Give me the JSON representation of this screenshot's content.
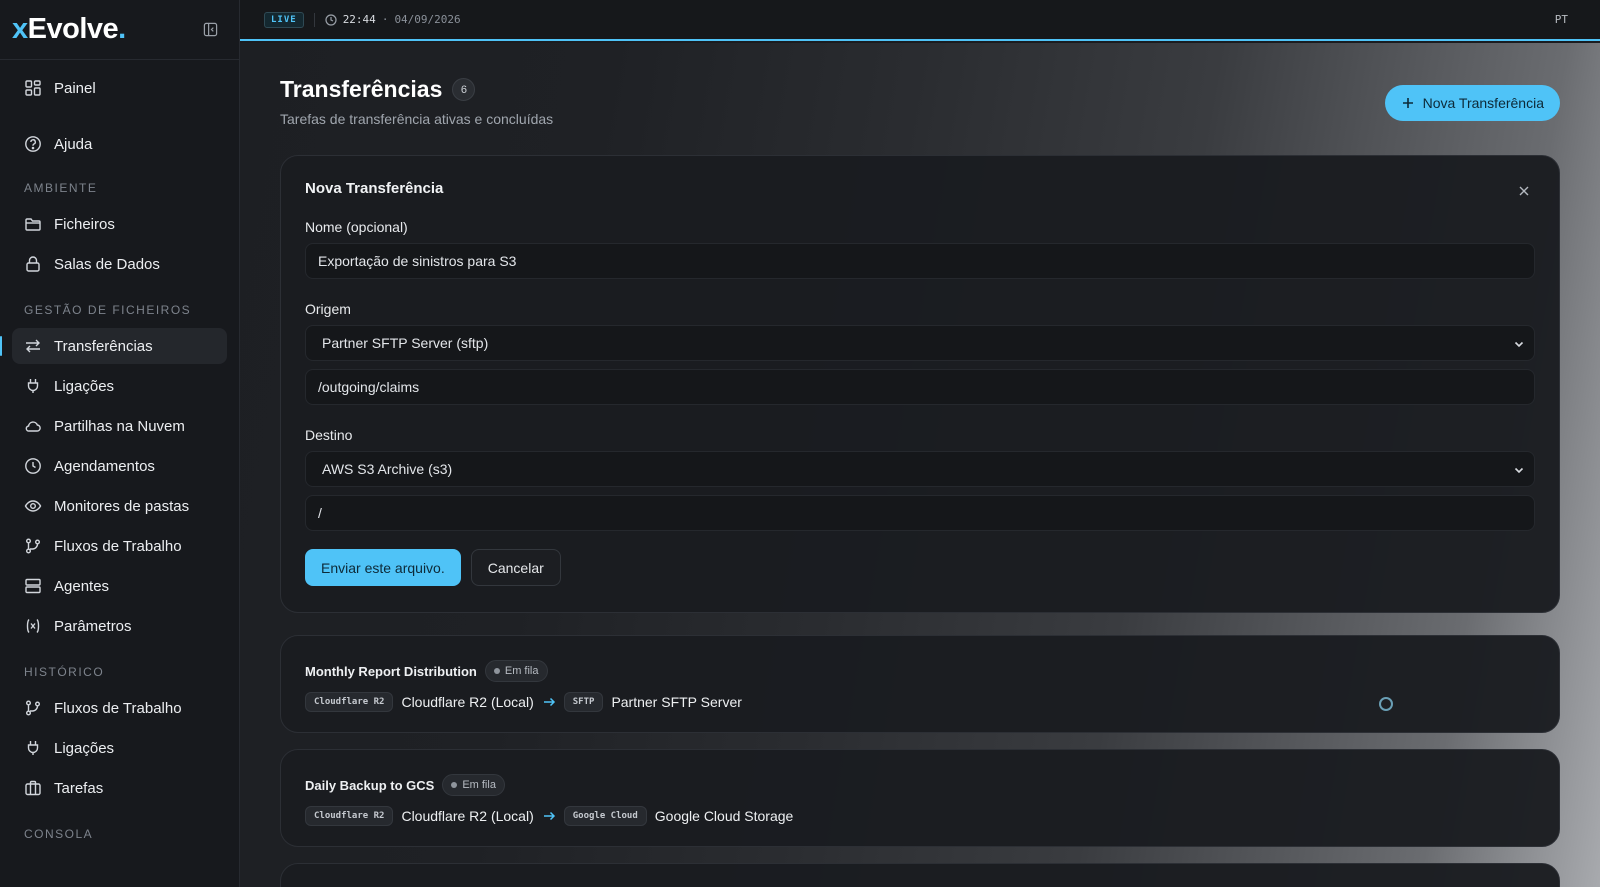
{
  "brand": {
    "x": "x",
    "name": "Evolve",
    "dot": "."
  },
  "topbar": {
    "live": "LIVE",
    "time": "22:44",
    "separator": "·",
    "date": "04/09/2026",
    "language": "PT"
  },
  "sidebar": {
    "top_items": [
      {
        "label": "Painel",
        "icon": "dashboard-icon"
      },
      {
        "label": "Ajuda",
        "icon": "help-icon"
      }
    ],
    "section_ambiente": "AMBIENTE",
    "ambiente_items": [
      {
        "label": "Ficheiros",
        "icon": "folder-icon"
      },
      {
        "label": "Salas de Dados",
        "icon": "lock-icon"
      }
    ],
    "section_gestao": "GESTÃO DE FICHEIROS",
    "gestao_items": [
      {
        "label": "Transferências",
        "icon": "transfer-icon",
        "active": true
      },
      {
        "label": "Ligações",
        "icon": "plug-icon"
      },
      {
        "label": "Partilhas na Nuvem",
        "icon": "cloud-icon"
      },
      {
        "label": "Agendamentos",
        "icon": "clock-icon"
      },
      {
        "label": "Monitores de pastas",
        "icon": "eye-icon"
      },
      {
        "label": "Fluxos de Trabalho",
        "icon": "workflow-icon"
      },
      {
        "label": "Agentes",
        "icon": "server-icon"
      },
      {
        "label": "Parâmetros",
        "icon": "variable-icon"
      }
    ],
    "section_historico": "HISTÓRICO",
    "historico_items": [
      {
        "label": "Fluxos de Trabalho",
        "icon": "workflow-icon"
      },
      {
        "label": "Ligações",
        "icon": "plug-icon"
      },
      {
        "label": "Tarefas",
        "icon": "briefcase-icon"
      }
    ],
    "section_consola": "CONSOLA"
  },
  "page": {
    "title": "Transferências",
    "count": "6",
    "subtitle": "Tarefas de transferência ativas e concluídas",
    "new_button": "Nova Transferência"
  },
  "form": {
    "title": "Nova Transferência",
    "name_label": "Nome (opcional)",
    "name_value": "Exportação de sinistros para S3",
    "origin_label": "Origem",
    "origin_select": "Partner SFTP Server (sftp)",
    "origin_path": "/outgoing/claims",
    "dest_label": "Destino",
    "dest_select": "AWS S3 Archive (s3)",
    "dest_path": "/",
    "submit": "Enviar este arquivo.",
    "cancel": "Cancelar"
  },
  "jobs": [
    {
      "name": "Monthly Report Distribution",
      "status": "Em fila",
      "src_tag": "Cloudflare R2",
      "src": "Cloudflare R2 (Local)",
      "dst_tag": "SFTP",
      "dst": "Partner SFTP Server"
    },
    {
      "name": "Daily Backup to GCS",
      "status": "Em fila",
      "src_tag": "Cloudflare R2",
      "src": "Cloudflare R2 (Local)",
      "dst_tag": "Google Cloud",
      "dst": "Google Cloud Storage"
    }
  ],
  "colors": {
    "accent": "#4fc3f7",
    "sidebar_bg": "#17191d",
    "card_bg": "#1a1c20"
  }
}
